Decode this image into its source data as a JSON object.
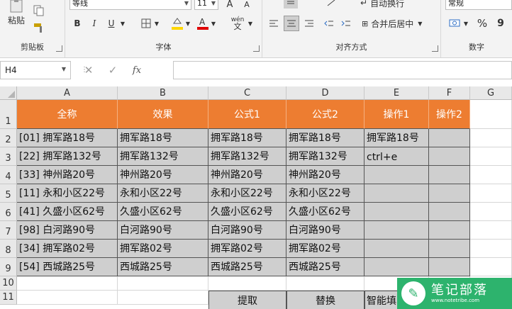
{
  "ribbon": {
    "clipboard": {
      "paste_label": "粘贴",
      "group_label": "剪贴板"
    },
    "font": {
      "font_name": "等线",
      "font_size": "11",
      "group_label": "字体",
      "bold": "B",
      "italic": "I",
      "underline": "U",
      "grow": "A",
      "shrink": "A",
      "wen": "wén"
    },
    "alignment": {
      "wrap_label": "自动换行",
      "merge_label": "合并后居中",
      "group_label": "对齐方式"
    },
    "number": {
      "format": "常规",
      "percent": "%",
      "comma": "9",
      "group_label": "数字"
    }
  },
  "formula_bar": {
    "name_box": "H4",
    "cancel": "✕",
    "enter": "✓",
    "fx": "fx",
    "formula": ""
  },
  "columns": [
    "A",
    "B",
    "C",
    "D",
    "E",
    "F",
    "G"
  ],
  "rows": [
    "1",
    "2",
    "3",
    "4",
    "5",
    "6",
    "7",
    "8",
    "9",
    "10",
    "11"
  ],
  "headers": [
    "全称",
    "效果",
    "公式1",
    "公式2",
    "操作1",
    "操作2"
  ],
  "data_rows": [
    [
      "[01] 拥军路18号",
      "拥军路18号",
      "拥军路18号",
      "拥军路18号",
      "拥军路18号",
      ""
    ],
    [
      "[22] 拥军路132号",
      "拥军路132号",
      "拥军路132号",
      "拥军路132号",
      "ctrl+e",
      ""
    ],
    [
      "[33] 神州路20号",
      "神州路20号",
      "神州路20号",
      "神州路20号",
      "",
      ""
    ],
    [
      "[11] 永和小区22号",
      "永和小区22号",
      "永和小区22号",
      "永和小区22号",
      "",
      ""
    ],
    [
      "[41] 久盛小区62号",
      "久盛小区62号",
      "久盛小区62号",
      "久盛小区62号",
      "",
      ""
    ],
    [
      "[98] 白河路90号",
      "白河路90号",
      "白河路90号",
      "白河路90号",
      "",
      ""
    ],
    [
      "[34] 拥军路02号",
      "拥军路02号",
      "拥军路02号",
      "拥军路02号",
      "",
      ""
    ],
    [
      "[54] 西城路25号",
      "西城路25号",
      "西城路25号",
      "西城路25号",
      "",
      ""
    ]
  ],
  "row11_labels": [
    "提取",
    "替换",
    "智能填"
  ],
  "watermark": {
    "title": "笔记部落",
    "url": "www.notetribe.com"
  },
  "colors": {
    "header_fill": "#ed7d31",
    "data_fill": "#cfcfcf",
    "watermark": "#2db36d"
  }
}
